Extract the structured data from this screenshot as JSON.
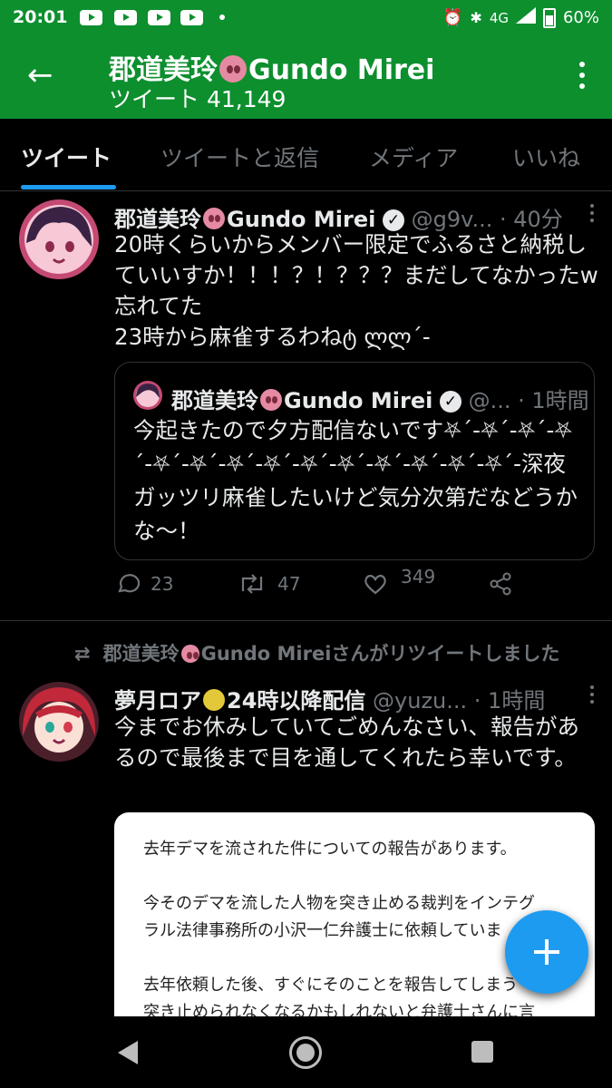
{
  "status_bar": {
    "time": "20:01",
    "network": "4G",
    "battery": "60%"
  },
  "header": {
    "name": "郡道美玲",
    "name_suffix": "Gundo Mirei",
    "tweet_count_label": "ツイート 41,149"
  },
  "tabs": [
    {
      "label": "ツイート",
      "active": true
    },
    {
      "label": "ツイートと返信",
      "active": false
    },
    {
      "label": "メディア",
      "active": false
    },
    {
      "label": "いいね",
      "active": false
    }
  ],
  "tweet1": {
    "name": "郡道美玲",
    "name_suffix": "Gundo Mirei",
    "handle": "@g9v...",
    "time": "· 40分",
    "text": "20時くらいからメンバー限定でふるさと納税していいすか！！！？！？？？まだしてなかったw忘れてた\n23時から麻雀するわねტ ლლ´-",
    "quote": {
      "name": "郡道美玲",
      "name_suffix": "Gundo Mirei",
      "handle": "@...",
      "time": "· 1時間",
      "text": "今起きたので夕方配信ないです⛧´-⛧´-⛧´-⛧´-⛧´-⛧´-⛧´-⛧´-⛧´-⛧´-⛧´-⛧´-⛧´-⛧´-深夜ガッツリ麻雀したいけど気分次第だなどうかな〜！"
    },
    "replies": "23",
    "retweets": "47",
    "likes": "349"
  },
  "retweet_context": {
    "label": "郡道美玲",
    "label_suffix": "Gundo Mireiさんがリツイートしました"
  },
  "tweet2": {
    "name": "夢月ロア",
    "name_suffix": "24時以降配信",
    "handle": "@yuzu...",
    "time": "· 1時間",
    "text": "今までお休みしていてごめんなさい、報告があるので最後まで目を通してくれたら幸いです。",
    "image_lines": [
      "去年デマを流された件についての報告があります。",
      "今そのデマを流した人物を突き止める裁判をインテグ",
      "ラル法律事務所の小沢一仁弁護士に依頼していま",
      "去年依頼した後、すぐにそのことを報告してしまう",
      "突き止められなくなるかもしれないと弁護士さんに言"
    ]
  }
}
